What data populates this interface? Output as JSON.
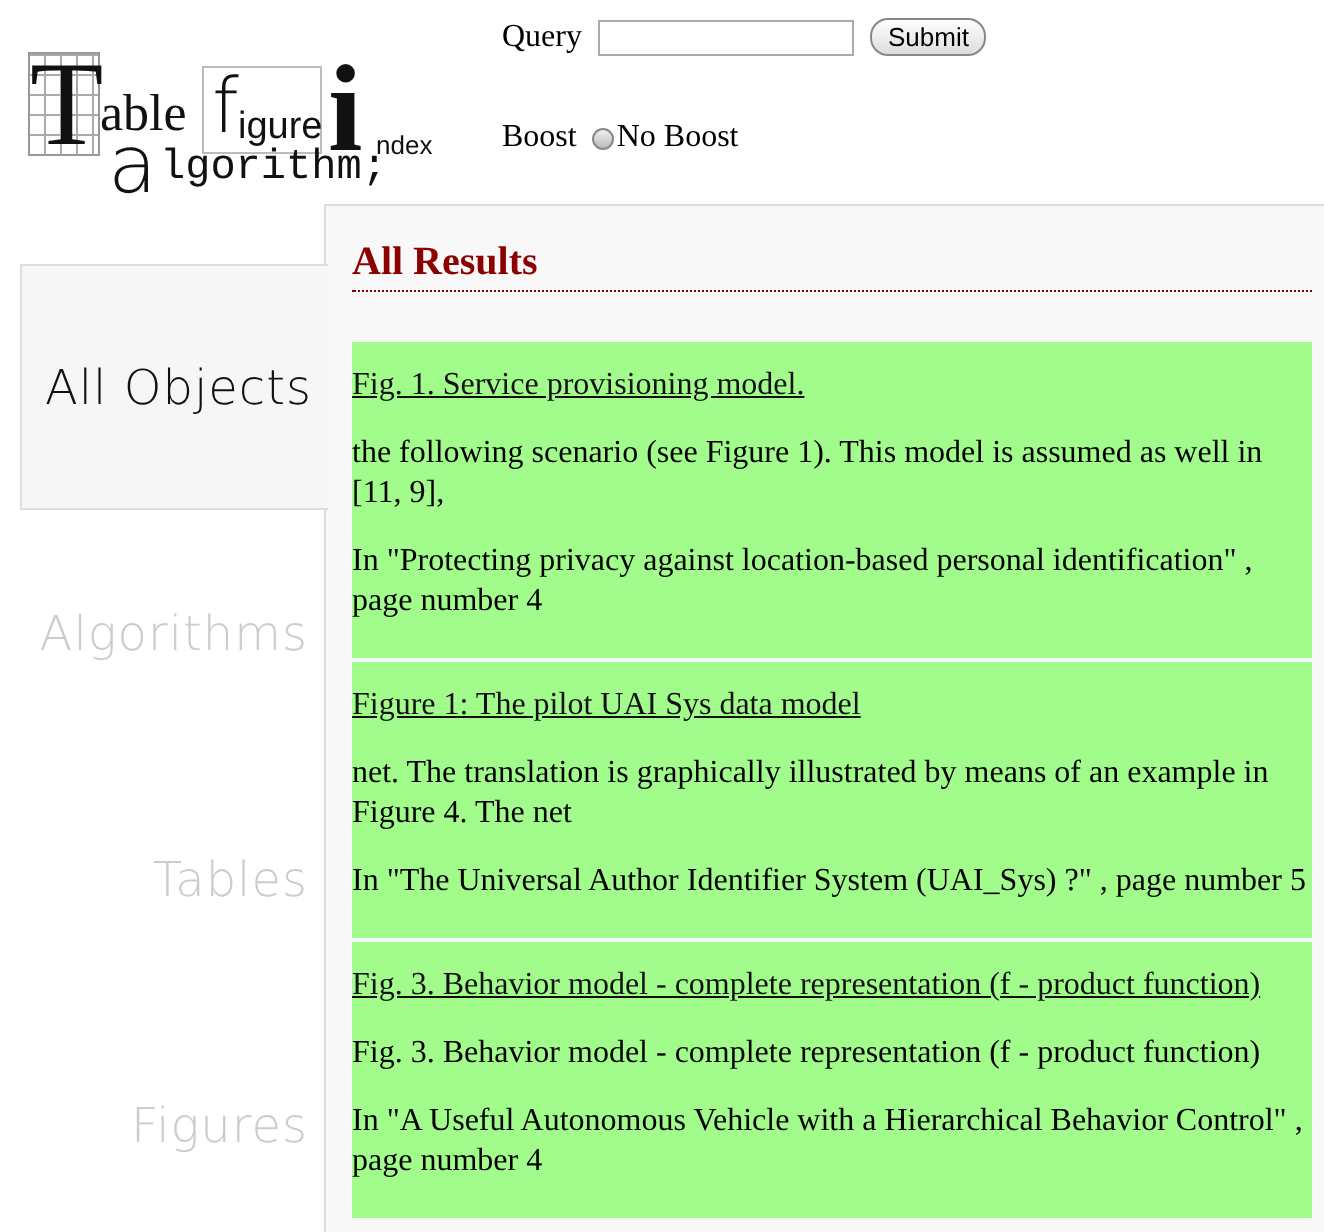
{
  "logo": {
    "parts": [
      {
        "kind": "initial-grid",
        "text": "T"
      },
      {
        "kind": "rest",
        "text": "able"
      },
      {
        "kind": "initial-boxed",
        "text": "f"
      },
      {
        "kind": "rest-sans",
        "text": "igure"
      },
      {
        "kind": "initial-bold",
        "text": "i"
      },
      {
        "kind": "small-sans",
        "text": "ndex"
      },
      {
        "kind": "initial-round",
        "text": "a"
      },
      {
        "kind": "mono",
        "text": "lgorithm;"
      }
    ]
  },
  "search": {
    "label": "Query",
    "button": "Submit"
  },
  "boost": {
    "label": "Boost",
    "options": [
      {
        "label": "No Boost",
        "selected": false
      }
    ]
  },
  "sidebar": {
    "items": [
      {
        "label": "All Objects",
        "selected": true
      },
      {
        "label": "Algorithms",
        "selected": false
      },
      {
        "label": "Tables",
        "selected": false
      },
      {
        "label": "Figures",
        "selected": false
      }
    ]
  },
  "results": {
    "heading": "All Results",
    "items": [
      {
        "title": "Fig. 1. Service provisioning model.",
        "snippet": "the following scenario (see Figure 1). This model is assumed as well in [11, 9],",
        "source": "In \"Protecting privacy against location-based personal identification\" , page number 4"
      },
      {
        "title": "Figure 1: The pilot UAI  Sys data model",
        "snippet": "net. The translation is graphically illustrated by means of an example in Figure 4. The net",
        "source": "In \"The Universal Author Identifier System (UAI_Sys) ?\" , page number 5"
      },
      {
        "title": "Fig. 3. Behavior model - complete representation (f - product function)",
        "snippet": "Fig. 3. Behavior model - complete representation (f - product function)",
        "source": "In \"A Useful Autonomous Vehicle with a Hierarchical Behavior Control\" , page number 4"
      }
    ]
  }
}
